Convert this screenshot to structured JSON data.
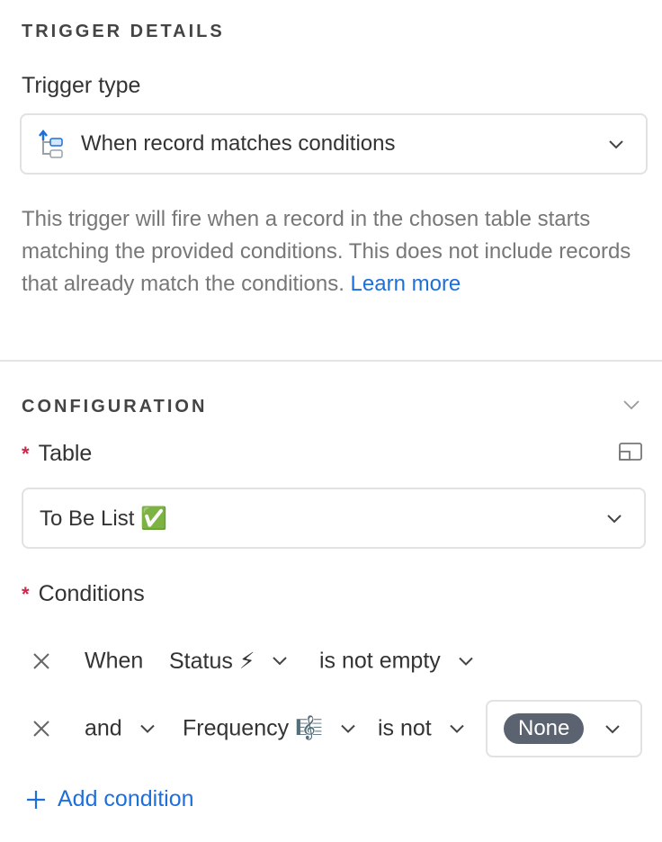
{
  "trigger_details": {
    "heading": "TRIGGER DETAILS",
    "trigger_type_label": "Trigger type",
    "trigger_type_value": "When record matches conditions",
    "description": "This trigger will fire when a record in the chosen table starts matching the provided conditions. This does not include records that already match the conditions.",
    "learn_more": "Learn more"
  },
  "configuration": {
    "heading": "CONFIGURATION",
    "table_label": "Table",
    "table_value": "To Be List ✅",
    "conditions_label": "Conditions",
    "required_mark": "*",
    "conditions": [
      {
        "conjunction": "When",
        "field": "Status ⚡",
        "operator": "is not empty"
      },
      {
        "conjunction": "and",
        "field": "Frequency 🎼",
        "operator": "is not",
        "value": "None"
      }
    ],
    "add_condition": "Add condition"
  },
  "colors": {
    "accent": "#1d6fdc",
    "required": "#d0264a",
    "pill": "#5b6270"
  }
}
